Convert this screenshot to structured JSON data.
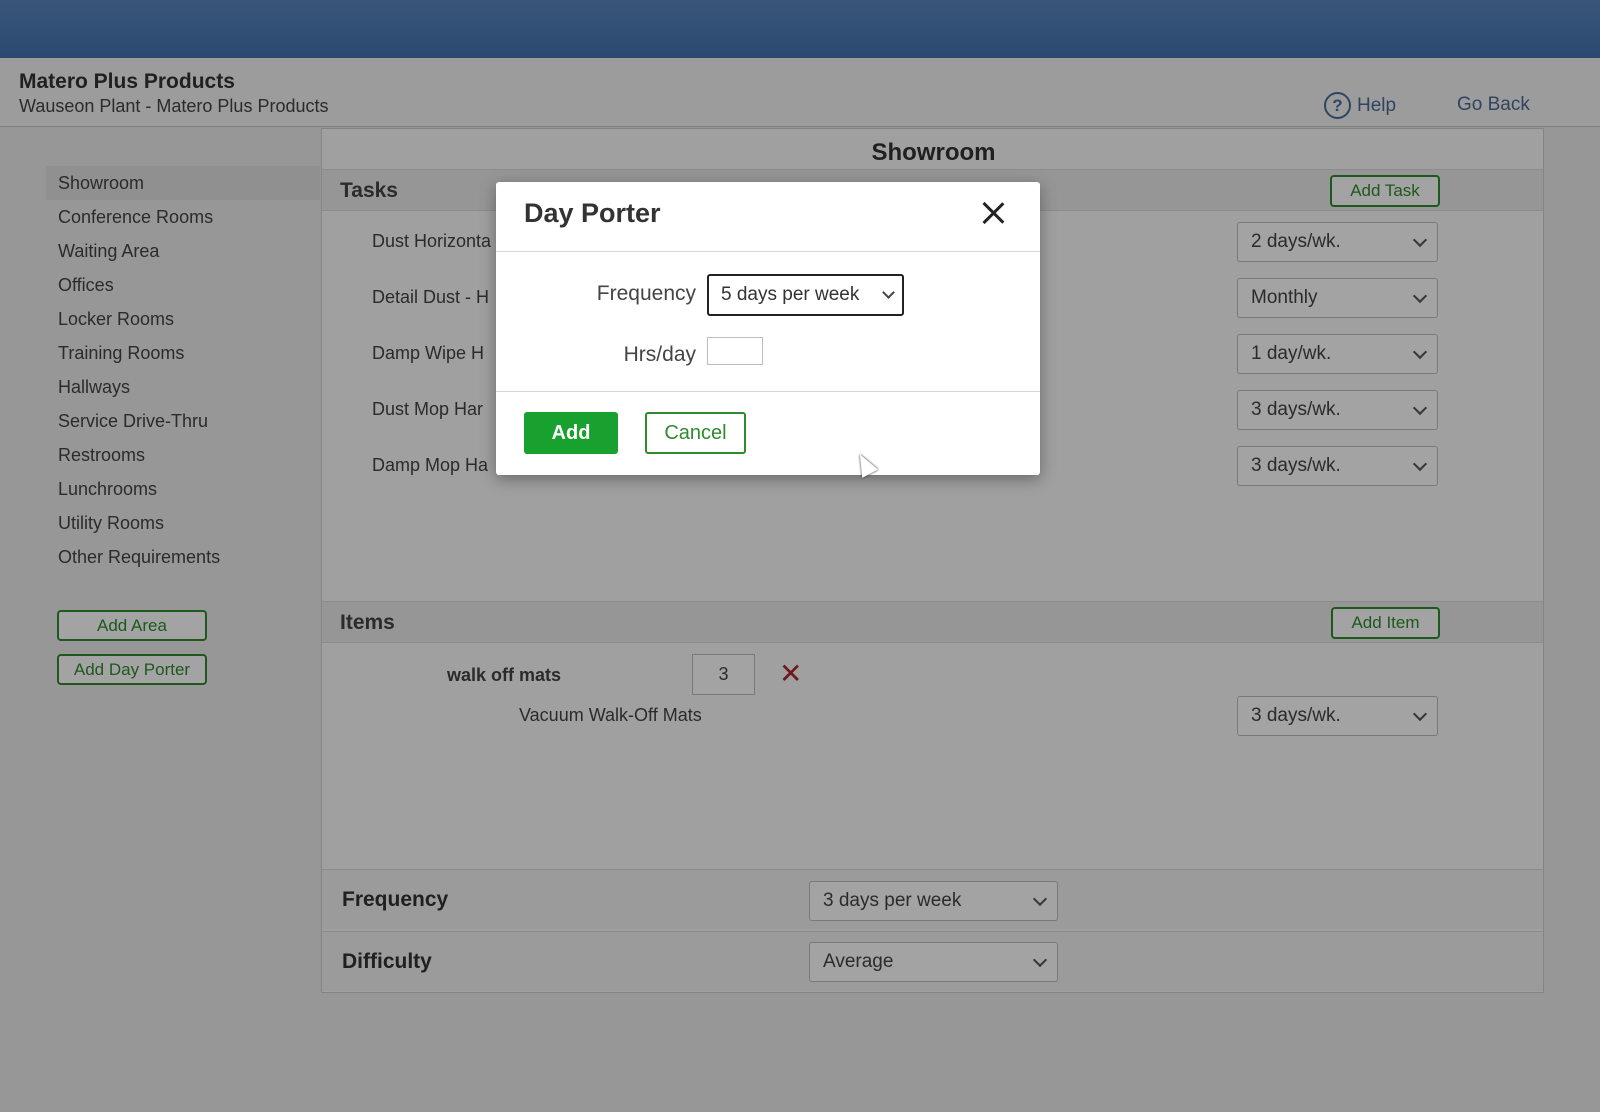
{
  "header": {
    "company": "Matero Plus Products",
    "plant": "Wauseon Plant - Matero Plus Products",
    "help_label": "Help",
    "help_icon_glyph": "?",
    "go_back_label": "Go Back"
  },
  "sidebar": {
    "items": [
      {
        "label": "Showroom"
      },
      {
        "label": "Conference Rooms"
      },
      {
        "label": "Waiting Area"
      },
      {
        "label": "Offices"
      },
      {
        "label": "Locker Rooms"
      },
      {
        "label": "Training Rooms"
      },
      {
        "label": "Hallways"
      },
      {
        "label": "Service Drive-Thru"
      },
      {
        "label": "Restrooms"
      },
      {
        "label": "Lunchrooms"
      },
      {
        "label": "Utility Rooms"
      },
      {
        "label": "Other Requirements"
      }
    ],
    "active_item": "Showroom",
    "add_area_label": "Add Area",
    "add_day_porter_label": "Add Day Porter"
  },
  "main": {
    "title": "Showroom",
    "tasks": {
      "heading": "Tasks",
      "add_label": "Add Task",
      "rows": [
        {
          "label": "Dust Horizonta",
          "frequency": "2 days/wk."
        },
        {
          "label": "Detail Dust - H",
          "frequency": "Monthly"
        },
        {
          "label": "Damp Wipe H",
          "frequency": "1 day/wk."
        },
        {
          "label": "Dust Mop Har",
          "frequency": "3 days/wk."
        },
        {
          "label": "Damp Mop Ha",
          "frequency": "3 days/wk."
        }
      ]
    },
    "items": {
      "heading": "Items",
      "add_label": "Add Item",
      "name": "walk off mats",
      "quantity": "3",
      "remove_glyph": "✕",
      "task_label": "Vacuum Walk-Off Mats",
      "task_frequency": "3 days/wk."
    },
    "frequency": {
      "label": "Frequency",
      "value": "3 days per week"
    },
    "difficulty": {
      "label": "Difficulty",
      "value": "Average"
    }
  },
  "modal": {
    "title": "Day Porter",
    "frequency_label": "Frequency",
    "frequency_value": "5 days per week",
    "hours_label": "Hrs/day",
    "hours_value": "",
    "add_label": "Add",
    "cancel_label": "Cancel"
  },
  "colors": {
    "topbar": "#4a7bb7",
    "accent_green": "#2e8b2e",
    "primary_button": "#19a12f",
    "remove_red": "#b0262f",
    "link_blue": "#4a6b94"
  }
}
